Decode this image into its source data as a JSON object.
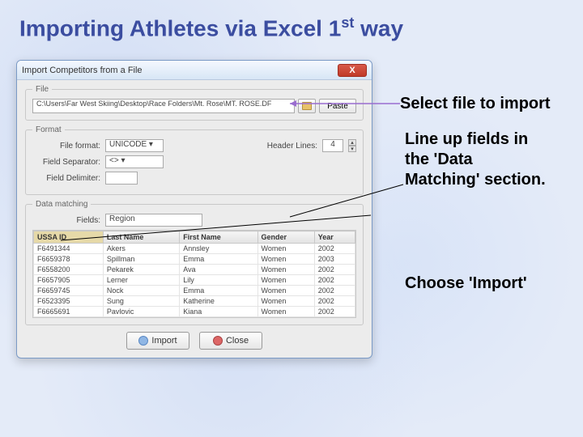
{
  "slide": {
    "title_pre": "Importing Athletes via Excel 1",
    "title_sup": "st",
    "title_post": " way"
  },
  "annotations": {
    "select_file": "Select file to import",
    "line_up": "Line up fields in the 'Data Matching' section.",
    "choose_import": "Choose 'Import'"
  },
  "dialog": {
    "title": "Import Competitors from a File",
    "close_label": "X"
  },
  "file": {
    "group_label": "File",
    "path": "C:\\Users\\Far West Skiing\\Desktop\\Race Folders\\Mt. Rose\\MT. ROSE.DF",
    "paste_label": "Paste"
  },
  "format": {
    "group_label": "Format",
    "file_format_label": "File format:",
    "file_format_value": "UNICODE",
    "header_lines_label": "Header Lines:",
    "header_lines_value": "4",
    "field_separator_label": "Field Separator:",
    "field_separator_value": "<>",
    "field_delimiter_label": "Field Delimiter:",
    "field_delimiter_value": ""
  },
  "data_matching": {
    "group_label": "Data matching",
    "fields_label": "Fields:",
    "fields_value": "Region",
    "columns": [
      "USSA ID",
      "Last Name",
      "First Name",
      "Gender",
      "Year"
    ],
    "rows": [
      [
        "F6491344",
        "Akers",
        "Annsley",
        "Women",
        "2002"
      ],
      [
        "F6659378",
        "Spillman",
        "Emma",
        "Women",
        "2003"
      ],
      [
        "F6558200",
        "Pekarek",
        "Ava",
        "Women",
        "2002"
      ],
      [
        "F6657905",
        "Lerner",
        "Lily",
        "Women",
        "2002"
      ],
      [
        "F6659745",
        "Nock",
        "Emma",
        "Women",
        "2002"
      ],
      [
        "F6523395",
        "Sung",
        "Katherine",
        "Women",
        "2002"
      ],
      [
        "F6665691",
        "Pavlovic",
        "Kiana",
        "Women",
        "2002"
      ]
    ]
  },
  "actions": {
    "import_label": "Import",
    "close_label": "Close"
  }
}
